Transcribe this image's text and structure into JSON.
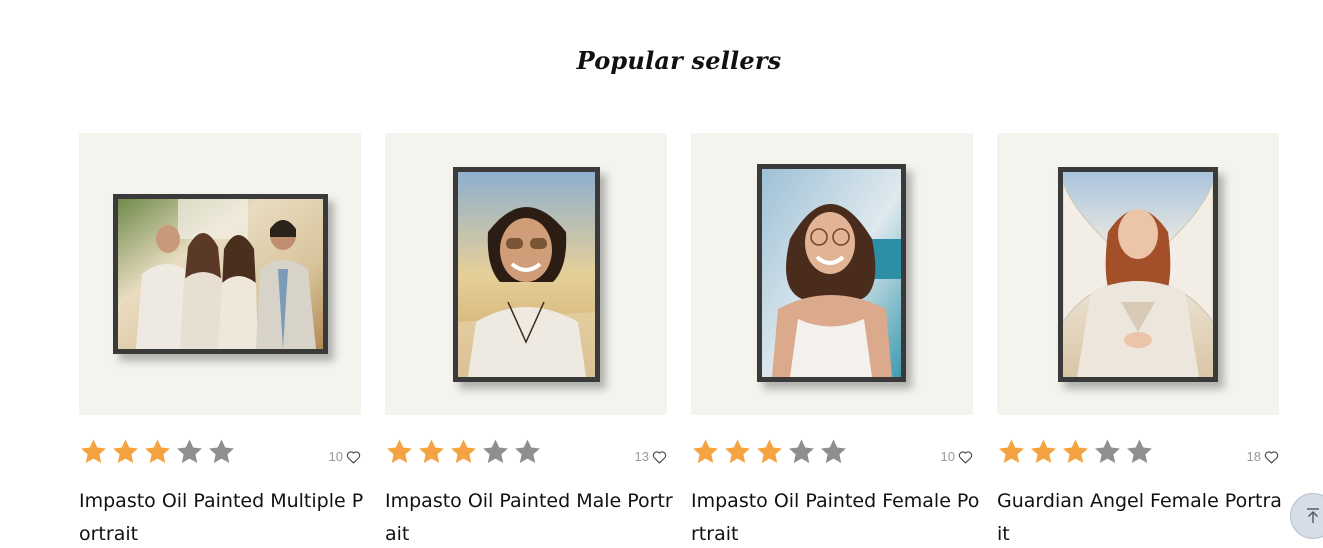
{
  "section": {
    "title": "Popular sellers"
  },
  "products": [
    {
      "name": "Impasto Oil Painted Multiple Portrait",
      "rating": 3,
      "rating_max": 5,
      "likes": "10",
      "image_icon": "family-portrait-painting"
    },
    {
      "name": "Impasto Oil Painted Male Portrait",
      "rating": 3,
      "rating_max": 5,
      "likes": "13",
      "image_icon": "male-portrait-painting"
    },
    {
      "name": "Impasto Oil Painted Female Portrait",
      "rating": 3,
      "rating_max": 5,
      "likes": "10",
      "image_icon": "female-portrait-painting"
    },
    {
      "name": "Guardian Angel Female Portrait",
      "rating": 3,
      "rating_max": 5,
      "likes": "18",
      "image_icon": "angel-portrait-painting"
    }
  ],
  "colors": {
    "star_filled": "#f4a340",
    "star_empty": "#8f8f8f",
    "card_bg": "#f4f3ee",
    "frame": "#3a3a3a"
  },
  "scroll_top": {
    "icon": "arrow-up-to-top-icon"
  }
}
